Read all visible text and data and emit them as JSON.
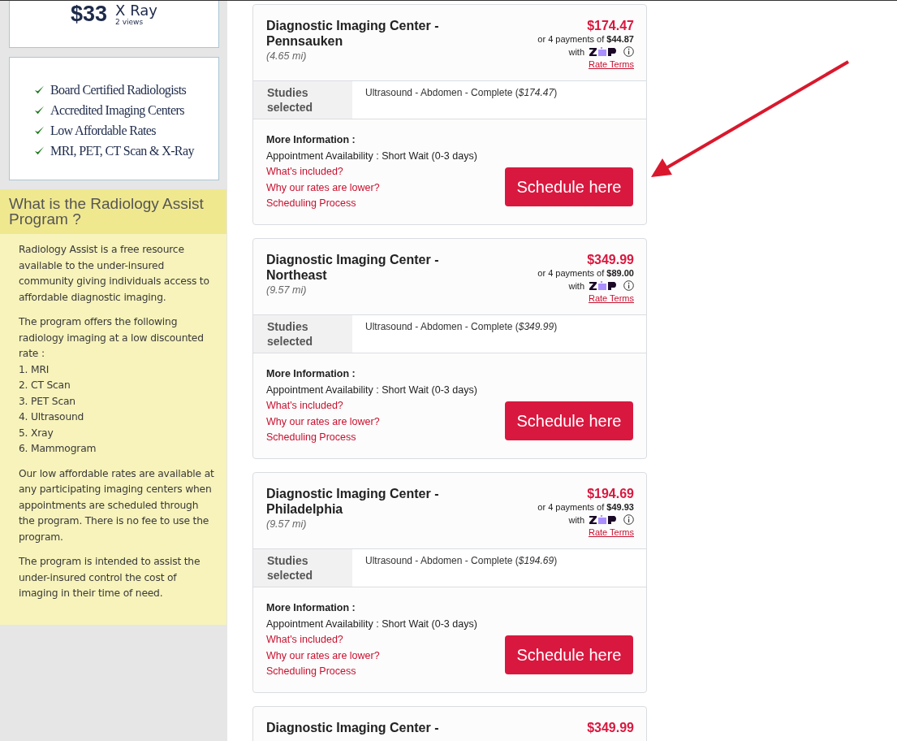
{
  "promo": {
    "price": "$33",
    "title": "X Ray",
    "subtitle": "2 views"
  },
  "features": [
    "Board Certified Radiologists",
    "Accredited Imaging Centers",
    "Low Affordable Rates",
    "MRI, PET, CT Scan & X-Ray"
  ],
  "program": {
    "heading": "What is the Radiology Assist Program ?",
    "paragraphs": [
      [
        "Radiology Assist is a free resource available to the under-insured community giving individuals access to affordable diagnostic imaging."
      ],
      [
        "The program offers the following radiology imaging at a low discounted rate :",
        "1. MRI",
        "2. CT Scan",
        "3. PET Scan",
        "4. Ultrasound",
        "5. Xray",
        "6. Mammogram"
      ],
      [
        "Our low affordable rates are available at any participating imaging centers when appointments are scheduled through the program. There is no fee to use the program."
      ],
      [
        "The program is intended to assist the under-insured control the cost of imaging in their time of need."
      ]
    ]
  },
  "centers": [
    {
      "name": "Diagnostic Imaging Center - Pennsauken",
      "distance": "(4.65 mi)",
      "price": "$174.47",
      "installment": "or 4 payments of **$44.87**",
      "with": "with",
      "rate_terms": "Rate Terms",
      "studies_label": "Studies selected",
      "study": "Ultrasound - Abdomen - Complete (*$174.47*)",
      "more_info": "More Information :",
      "availability": "Appointment Availability : Short Wait (0-3 days)",
      "links": [
        "What's included?",
        "Why our rates are lower?",
        "Scheduling Process"
      ],
      "button": "Schedule here"
    },
    {
      "name": "Diagnostic Imaging Center - Northeast",
      "distance": "(9.57 mi)",
      "price": "$349.99",
      "installment": "or 4 payments of **$89.00**",
      "with": "with",
      "rate_terms": "Rate Terms",
      "studies_label": "Studies selected",
      "study": "Ultrasound - Abdomen - Complete (*$349.99*)",
      "more_info": "More Information :",
      "availability": "Appointment Availability : Short Wait (0-3 days)",
      "links": [
        "What's included?",
        "Why our rates are lower?",
        "Scheduling Process"
      ],
      "button": "Schedule here"
    },
    {
      "name": "Diagnostic Imaging Center - Philadelphia",
      "distance": "(9.57 mi)",
      "price": "$194.69",
      "installment": "or 4 payments of **$49.93**",
      "with": "with",
      "rate_terms": "Rate Terms",
      "studies_label": "Studies selected",
      "study": "Ultrasound - Abdomen - Complete (*$194.69*)",
      "more_info": "More Information :",
      "availability": "Appointment Availability : Short Wait (0-3 days)",
      "links": [
        "What's included?",
        "Why our rates are lower?",
        "Scheduling Process"
      ],
      "button": "Schedule here"
    },
    {
      "name": "Diagnostic Imaging Center -",
      "price": "$349.99"
    }
  ]
}
